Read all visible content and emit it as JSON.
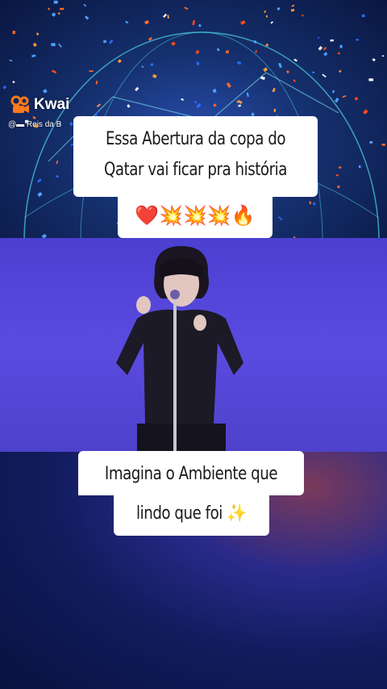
{
  "watermark": {
    "brand": "Kwai",
    "handle": "@▬ Reis da B"
  },
  "captions": {
    "top_line1": "Essa Abertura da copa do",
    "top_line2": "Qatar vai ficar pra história",
    "top_emojis": "❤️💥💥💥🔥",
    "bottom_line1": "Imagina o Ambiente que",
    "bottom_line2": "lindo que foi ✨"
  },
  "colors": {
    "caption_bg": "#ffffff",
    "caption_text": "#1a1a1a",
    "stage_purple": "#5a4be0",
    "top_blue": "#2a4fb0"
  }
}
